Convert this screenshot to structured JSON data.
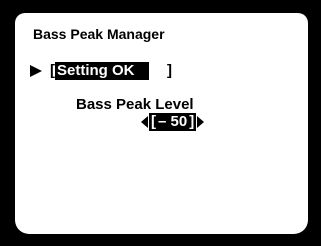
{
  "menu": {
    "title": "Bass Peak Manager",
    "setting": {
      "open_bracket": "[",
      "value": "Setting OK",
      "close_bracket": "]"
    },
    "bass_peak_level": {
      "label": "Bass Peak Level",
      "open_bracket": "[",
      "value": "– 50",
      "close_bracket": "]"
    }
  },
  "icons": {
    "cursor": "right-pointing-triangle",
    "decrease": "left-triangle",
    "increase": "right-triangle"
  },
  "colors": {
    "background": "#ffffff",
    "text": "#000000",
    "highlight_bg": "#000000",
    "highlight_text": "#ffffff",
    "frame": "#000000"
  }
}
